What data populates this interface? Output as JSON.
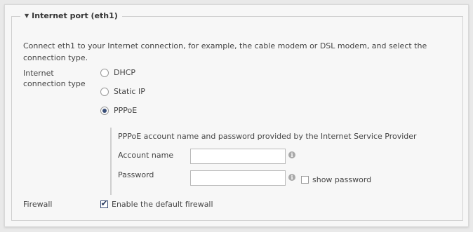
{
  "section": {
    "title": "Internet port (eth1)",
    "description": "Connect eth1 to your Internet connection, for example, the cable modem or DSL modem, and select the connection type."
  },
  "connection": {
    "label_line1": "Internet",
    "label_line2": "connection type",
    "options": [
      {
        "label": "DHCP",
        "selected": false
      },
      {
        "label": "Static IP",
        "selected": false
      },
      {
        "label": "PPPoE",
        "selected": true
      }
    ]
  },
  "pppoe": {
    "description": "PPPoE account name and password provided by the Internet Service Provider",
    "account_label": "Account name",
    "account_value": "",
    "password_label": "Password",
    "password_value": "",
    "show_password_label": "show password",
    "show_password_checked": false
  },
  "firewall": {
    "label": "Firewall",
    "enable_label": "Enable the default firewall",
    "checked": true
  }
}
